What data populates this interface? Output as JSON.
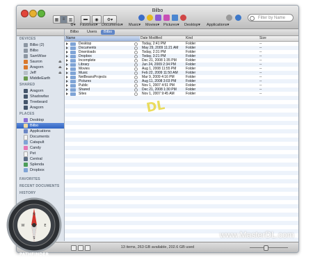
{
  "window": {
    "title": "Bilbo"
  },
  "search": {
    "placeholder": "Filter by Name"
  },
  "favorites_bar": {
    "items": [
      "Favorites▾",
      "Documents▾",
      "Music▾",
      "Movies▾",
      "Pictures▾",
      "Desktop▾",
      "Applications▾"
    ]
  },
  "pathbar": {
    "crumbs": [
      "Bilbo",
      "Users",
      "Bilbo"
    ]
  },
  "sidebar": {
    "sections": {
      "devices": "DEVICES",
      "shared": "SHARED",
      "places": "PLACES",
      "favorites": "FAVORITES",
      "recent_documents": "RECENT DOCUMENTS",
      "history": "HISTORY"
    },
    "devices": [
      "Bilbo (2)",
      "Bilbo",
      "SamWise",
      "Sauron",
      "Aragorn",
      "Jeff",
      "MiddleEarth"
    ],
    "shared": [
      "Shadowfax",
      "Treebeard",
      "Aragorn"
    ],
    "places": [
      "Desktop",
      "Bilbo",
      "Applications",
      "Documents",
      "Catapult",
      "Candy",
      "Pet",
      "Central",
      "Splenda",
      "Dropbox"
    ]
  },
  "columns": {
    "name": "Name",
    "date": "Date Modified",
    "kind": "Kind",
    "size": "Size"
  },
  "files": [
    {
      "name": "Desktop",
      "date": "Today, 2:41 PM",
      "kind": "Folder",
      "size": "--"
    },
    {
      "name": "Documents",
      "date": "May 29, 2009 11:21 AM",
      "kind": "Folder",
      "size": "--"
    },
    {
      "name": "Downloads",
      "date": "Today, 2:31 PM",
      "kind": "Folder",
      "size": "--"
    },
    {
      "name": "Dropbox",
      "date": "Today, 3:21 PM",
      "kind": "Folder",
      "size": "--"
    },
    {
      "name": "Incomplete",
      "date": "Dec 21, 2008 1:35 PM",
      "kind": "Folder",
      "size": "--"
    },
    {
      "name": "Library",
      "date": "Jun 24, 2009 2:34 PM",
      "kind": "Folder",
      "size": "--"
    },
    {
      "name": "Movies",
      "date": "Aug 1, 2008 11:55 PM",
      "kind": "Folder",
      "size": "--"
    },
    {
      "name": "Music",
      "date": "Feb 22, 2009 11:50 AM",
      "kind": "Folder",
      "size": "--"
    },
    {
      "name": "NetBeansProjects",
      "date": "Mar 9, 2009 4:16 PM",
      "kind": "Folder",
      "size": "--"
    },
    {
      "name": "Pictures",
      "date": "Aug 11, 2008 3:03 PM",
      "kind": "Folder",
      "size": "--"
    },
    {
      "name": "Public",
      "date": "Nov 1, 2007 4:51 PM",
      "kind": "Folder",
      "size": "--"
    },
    {
      "name": "Shared",
      "date": "Dec 21, 2008 1:30 PM",
      "kind": "Folder",
      "size": "--"
    },
    {
      "name": "Sites",
      "date": "Nov 1, 2007 9:45 AM",
      "kind": "Folder",
      "size": "--"
    }
  ],
  "status": {
    "text": "13 items, 263 GB available, 202.6 GB used"
  },
  "watermark": {
    "text": "www.MasterDL.com"
  },
  "badge": {
    "text": "PATHFINDER"
  },
  "colors": {
    "selection": "#3a6cc8",
    "folder": "#7fa4d6",
    "stripe": "#edf3fb"
  }
}
